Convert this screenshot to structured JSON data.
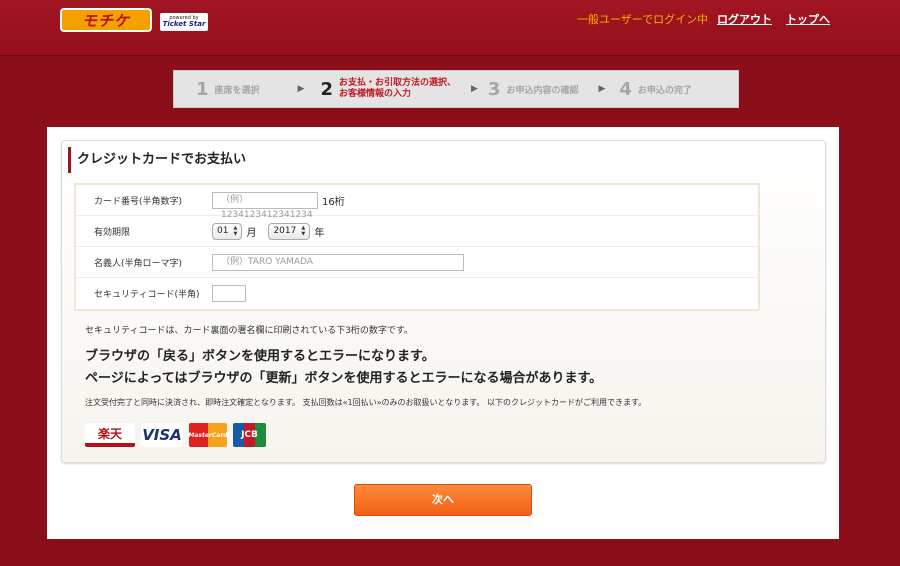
{
  "header": {
    "logo_text": "モチケ",
    "logo_sub_small": "powered by",
    "logo_sub_brand": "Ticket Star",
    "login_status": "一般ユーザーでログイン中",
    "logout": "ログアウト",
    "top": "トップへ"
  },
  "steps": [
    {
      "num": "1",
      "label": "座席を選択"
    },
    {
      "num": "2",
      "label": "お支払・お引取方法の選択、お客様情報の入力"
    },
    {
      "num": "3",
      "label": "お申込内容の確認"
    },
    {
      "num": "4",
      "label": "お申込の完了"
    }
  ],
  "step_arrow": "▶",
  "card": {
    "title": "クレジットカードでお支払い",
    "fields": {
      "card_number": {
        "label": "カード番号(半角数字)",
        "placeholder": "（例）1234123412341234",
        "unit": "16桁"
      },
      "expiry": {
        "label": "有効期限",
        "month": "01",
        "month_unit": "月",
        "year": "2017",
        "year_unit": "年"
      },
      "name": {
        "label": "名義人(半角ローマ字)",
        "placeholder": "（例）TARO YAMADA"
      },
      "security": {
        "label": "セキュリティコード(半角)",
        "value": ""
      }
    },
    "security_note": "セキュリティコードは、カード裏面の署名欄に印刷されている下3桁の数字です。",
    "warning_1": "ブラウザの「戻る」ボタンを使用するとエラーになります。",
    "warning_2": "ページによってはブラウザの「更新」ボタンを使用するとエラーになる場合があります。",
    "payment_note": "注文受付完了と同時に決済され、即時注文確定となります。 支払回数は«1回払い»のみのお取扱いとなります。 以下のクレジットカードがご利用できます。",
    "brands": [
      "楽天",
      "VISA",
      "MasterCard",
      "JCB"
    ]
  },
  "next_button": "次へ",
  "caret": "▲▼"
}
